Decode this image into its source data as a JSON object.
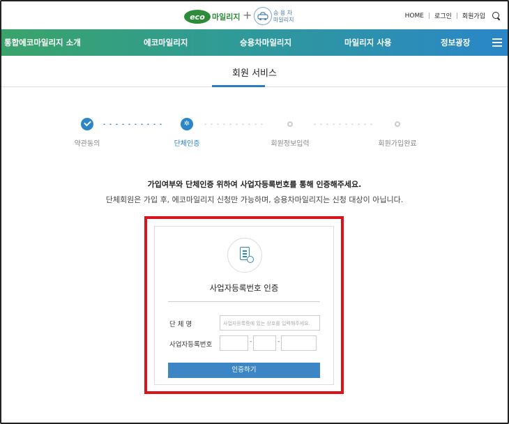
{
  "header": {
    "logo_eco": "eco",
    "logo_mileage": "마일리지",
    "logo_car_line1": "승 용 차",
    "logo_car_line2": "마일리지",
    "plus": "+",
    "links": [
      "HOME",
      "로그인",
      "회원가입"
    ],
    "separator": "|"
  },
  "nav": {
    "items": [
      "통합에코마일리지 소개",
      "에코마일리지",
      "승용차마일리지",
      "마일리지 사용",
      "정보광장"
    ]
  },
  "page": {
    "title": "회원 서비스"
  },
  "steps": [
    {
      "label": "약관동의",
      "state": "done"
    },
    {
      "label": "단체인증",
      "state": "active"
    },
    {
      "label": "회원정보입력",
      "state": "idle"
    },
    {
      "label": "회원가입완료",
      "state": "idle"
    }
  ],
  "description": {
    "line1": "가입여부와 단체인증 위하여 사업자등록번호를 통해 인증해주세요.",
    "line2": "단체회원은 가입 후, 에코마일리지 신청만 가능하며, 승용차마일리지는 신청 대상이 아닙니다."
  },
  "form": {
    "title": "사업자등록번호 인증",
    "name_label": "단 체 명",
    "name_placeholder": "사업자등록증에 있는 상호를 입력해주세요.",
    "bizno_label": "사업자등록번호",
    "dash": "-",
    "submit_label": "인증하기"
  },
  "colors": {
    "accent": "#2a86c8",
    "highlight": "#d9151b",
    "nav_start": "#3aa36a",
    "nav_end": "#2a86c8"
  }
}
